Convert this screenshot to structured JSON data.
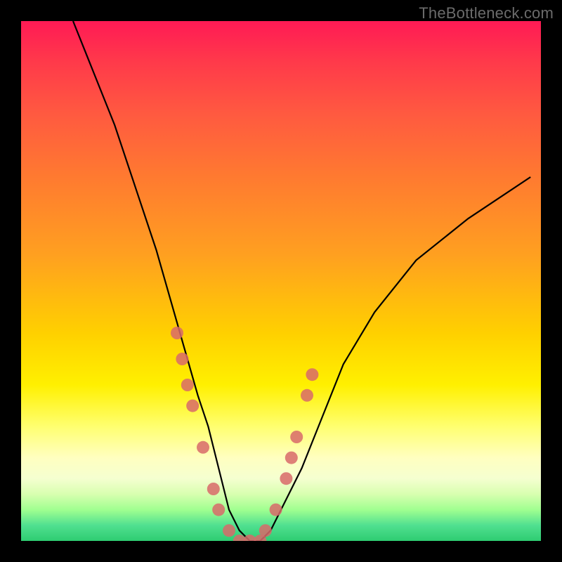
{
  "watermark": {
    "text": "TheBottleneck.com"
  },
  "chart_data": {
    "type": "line",
    "title": "",
    "xlabel": "",
    "ylabel": "",
    "xlim": [
      0,
      100
    ],
    "ylim": [
      0,
      100
    ],
    "series": [
      {
        "name": "bottleneck-curve",
        "x": [
          10,
          14,
          18,
          22,
          26,
          30,
          34,
          36,
          38,
          40,
          42,
          44,
          46,
          48,
          50,
          54,
          58,
          62,
          68,
          76,
          86,
          98
        ],
        "values": [
          100,
          90,
          80,
          68,
          56,
          42,
          28,
          22,
          14,
          6,
          2,
          0,
          0,
          2,
          6,
          14,
          24,
          34,
          44,
          54,
          62,
          70
        ]
      }
    ],
    "markers": {
      "name": "highlighted-points",
      "color": "#d86a6a",
      "x": [
        30,
        31,
        32,
        33,
        35,
        37,
        38,
        40,
        42,
        44,
        46,
        47,
        49,
        51,
        52,
        53,
        55,
        56
      ],
      "values": [
        40,
        35,
        30,
        26,
        18,
        10,
        6,
        2,
        0,
        0,
        0,
        2,
        6,
        12,
        16,
        20,
        28,
        32
      ]
    },
    "grid": false,
    "legend": false
  }
}
